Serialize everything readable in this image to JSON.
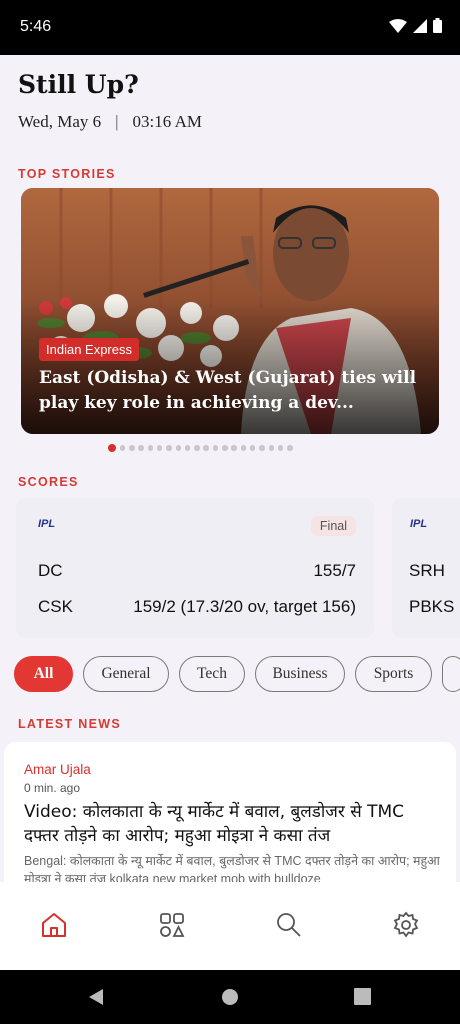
{
  "status_bar": {
    "time": "5:46"
  },
  "header": {
    "greeting": "Still Up?",
    "date": "Wed, May 6",
    "separator": "|",
    "time": "03:16 AM"
  },
  "top_stories": {
    "label": "TOP STORIES",
    "featured": {
      "source": "Indian Express",
      "title": "East (Odisha) & West (Gujarat) ties will play key role in achieving a dev..."
    },
    "dot_count": 20,
    "active_dot": 0
  },
  "scores": {
    "label": "SCORES",
    "matches": [
      {
        "league": "IPL",
        "status": "Final",
        "team1": {
          "name": "DC",
          "score": "155/7"
        },
        "team2": {
          "name": "CSK",
          "score": "159/2 (17.3/20 ov, target 156)"
        }
      },
      {
        "league": "IPL",
        "team1": {
          "name": "SRH"
        },
        "team2": {
          "name": "PBKS"
        }
      }
    ]
  },
  "categories": [
    "All",
    "General",
    "Tech",
    "Business",
    "Sports"
  ],
  "latest_news": {
    "label": "LATEST NEWS",
    "items": [
      {
        "source": "Amar Ujala",
        "time": "0 min. ago",
        "title": "Video: कोलकाता के न्यू मार्केट में बवाल, बुलडोजर से TMC दफ्तर तोड़ने का आरोप; महुआ मोइत्रा ने कसा तंज",
        "description": "Bengal: कोलकाता के न्यू मार्केट में बवाल, बुलडोजर से TMC दफ्तर तोड़ने का आरोप; महुआ मोइत्रा ने कसा तंज kolkata new market mob with bulldoze"
      }
    ]
  },
  "bottom_nav": {
    "items": [
      "home-icon",
      "categories-icon",
      "search-icon",
      "settings-icon"
    ],
    "active": "home-icon"
  },
  "colors": {
    "accent": "#d6302c",
    "background": "#f4f2f8"
  }
}
